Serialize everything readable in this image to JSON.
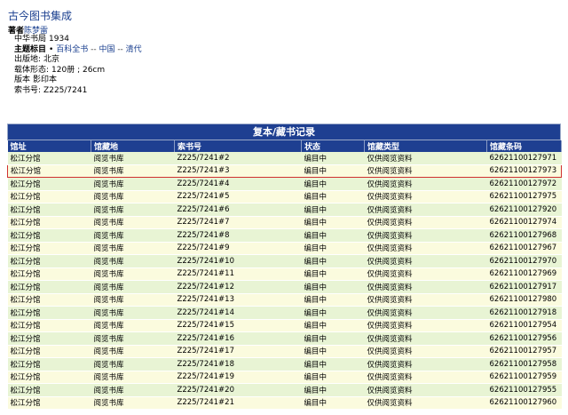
{
  "book": {
    "title": "古今图书集成",
    "author_label": "著者",
    "author": "陈梦雷"
  },
  "meta": {
    "rows": [
      {
        "key": "中华书局",
        "value": "1934",
        "bold": false
      },
      {
        "key": "主题标目",
        "bold": true,
        "links": [
          "百科全书",
          "中国",
          "清代"
        ],
        "bullet": "•"
      },
      {
        "key": "出版地:",
        "value": "北京",
        "bold": false
      },
      {
        "key": "载体形态:",
        "value": "120册 ; 26cm",
        "bold": false
      },
      {
        "key": "版本",
        "value": "影印本",
        "bold": false
      },
      {
        "key": "索书号:",
        "value": "Z225/7241",
        "bold": false
      }
    ],
    "link_sep": " -- "
  },
  "holdings": {
    "header": "复本/藏书记录",
    "columns": [
      "馆址",
      "馆藏地",
      "索书号",
      "状态",
      "馆藏类型",
      "馆藏条码"
    ],
    "rows": [
      [
        "松江分馆",
        "阅览书库",
        "Z225/7241#2",
        "编目中",
        "仅供阅览资料",
        "62621100127971"
      ],
      [
        "松江分馆",
        "阅览书库",
        "Z225/7241#3",
        "编目中",
        "仅供阅览资料",
        "62621100127973"
      ],
      [
        "松江分馆",
        "阅览书库",
        "Z225/7241#4",
        "编目中",
        "仅供阅览资料",
        "62621100127972"
      ],
      [
        "松江分馆",
        "阅览书库",
        "Z225/7241#5",
        "编目中",
        "仅供阅览资料",
        "62621100127975"
      ],
      [
        "松江分馆",
        "阅览书库",
        "Z225/7241#6",
        "编目中",
        "仅供阅览资料",
        "62621100127920"
      ],
      [
        "松江分馆",
        "阅览书库",
        "Z225/7241#7",
        "编目中",
        "仅供阅览资料",
        "62621100127974"
      ],
      [
        "松江分馆",
        "阅览书库",
        "Z225/7241#8",
        "编目中",
        "仅供阅览资料",
        "62621100127968"
      ],
      [
        "松江分馆",
        "阅览书库",
        "Z225/7241#9",
        "编目中",
        "仅供阅览资料",
        "62621100127967"
      ],
      [
        "松江分馆",
        "阅览书库",
        "Z225/7241#10",
        "编目中",
        "仅供阅览资料",
        "62621100127970"
      ],
      [
        "松江分馆",
        "阅览书库",
        "Z225/7241#11",
        "编目中",
        "仅供阅览资料",
        "62621100127969"
      ],
      [
        "松江分馆",
        "阅览书库",
        "Z225/7241#12",
        "编目中",
        "仅供阅览资料",
        "62621100127917"
      ],
      [
        "松江分馆",
        "阅览书库",
        "Z225/7241#13",
        "编目中",
        "仅供阅览资料",
        "62621100127980"
      ],
      [
        "松江分馆",
        "阅览书库",
        "Z225/7241#14",
        "编目中",
        "仅供阅览资料",
        "62621100127918"
      ],
      [
        "松江分馆",
        "阅览书库",
        "Z225/7241#15",
        "编目中",
        "仅供阅览资料",
        "62621100127954"
      ],
      [
        "松江分馆",
        "阅览书库",
        "Z225/7241#16",
        "编目中",
        "仅供阅览资料",
        "62621100127956"
      ],
      [
        "松江分馆",
        "阅览书库",
        "Z225/7241#17",
        "编目中",
        "仅供阅览资料",
        "62621100127957"
      ],
      [
        "松江分馆",
        "阅览书库",
        "Z225/7241#18",
        "编目中",
        "仅供阅览资料",
        "62621100127958"
      ],
      [
        "松江分馆",
        "阅览书库",
        "Z225/7241#19",
        "编目中",
        "仅供阅览资料",
        "62621100127959"
      ],
      [
        "松江分馆",
        "阅览书库",
        "Z225/7241#20",
        "编目中",
        "仅供阅览资料",
        "62621100127955"
      ],
      [
        "松江分馆",
        "阅览书库",
        "Z225/7241#21",
        "编目中",
        "仅供阅览资料",
        "62621100127960"
      ]
    ],
    "selected_row_index": 1
  },
  "colors": {
    "link": "#1a3f8f",
    "header_bg": "#1e3f91",
    "row_odd": "#e8f4d4",
    "row_even": "#fbfbde",
    "selected_border": "#d03030"
  }
}
